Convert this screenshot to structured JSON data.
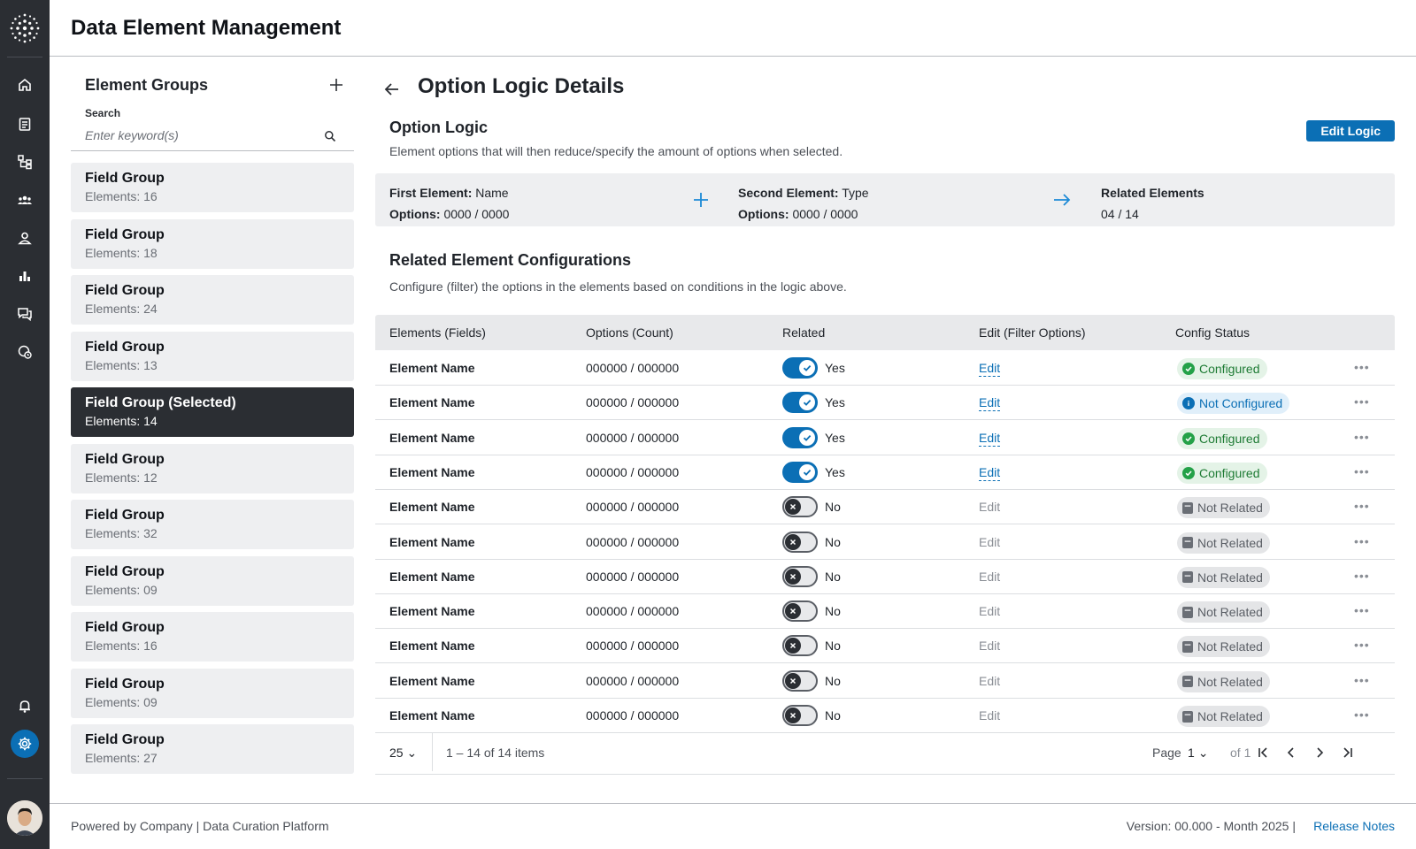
{
  "app": {
    "title": "Data Element Management"
  },
  "nav": {
    "items": [
      "home-icon",
      "clipboard-icon",
      "hierarchy-icon",
      "team-icon",
      "user-icon",
      "bar-chart-icon",
      "chat-icon",
      "settings-clock-icon"
    ],
    "bottom": [
      "bell-icon",
      "gear-icon",
      "avatar"
    ]
  },
  "groups": {
    "title": "Element Groups",
    "search_label": "Search",
    "search_placeholder": "Enter keyword(s)",
    "items": [
      {
        "name": "Field Group",
        "count": "Elements: 16",
        "selected": false
      },
      {
        "name": "Field Group",
        "count": "Elements: 18",
        "selected": false
      },
      {
        "name": "Field Group",
        "count": "Elements: 24",
        "selected": false
      },
      {
        "name": "Field Group",
        "count": "Elements: 13",
        "selected": false
      },
      {
        "name": "Field Group (Selected)",
        "count": "Elements: 14",
        "selected": true
      },
      {
        "name": "Field Group",
        "count": "Elements: 12",
        "selected": false
      },
      {
        "name": "Field Group",
        "count": "Elements: 32",
        "selected": false
      },
      {
        "name": "Field Group",
        "count": "Elements: 09",
        "selected": false
      },
      {
        "name": "Field Group",
        "count": "Elements: 16",
        "selected": false
      },
      {
        "name": "Field Group",
        "count": "Elements: 09",
        "selected": false
      },
      {
        "name": "Field Group",
        "count": "Elements: 27",
        "selected": false
      }
    ]
  },
  "main": {
    "page_title": "Option Logic Details",
    "logic": {
      "title": "Option Logic",
      "description": "Element options that will then reduce/specify the amount of options when selected.",
      "edit_button": "Edit Logic",
      "first_label": "First Element:",
      "first_value": "Name",
      "first_options_label": "Options:",
      "first_options_value": "0000 / 0000",
      "second_label": "Second Element:",
      "second_value": "Type",
      "second_options_label": "Options:",
      "second_options_value": "0000 / 0000",
      "related_label": "Related Elements",
      "related_value": "04 / 14"
    },
    "config": {
      "title": "Related Element Configurations",
      "description": "Configure (filter) the options in the elements based on conditions in the logic above.",
      "columns": [
        "Elements (Fields)",
        "Options (Count)",
        "Related",
        "Edit (Filter Options)",
        "Config Status"
      ],
      "rows": [
        {
          "name": "Element Name",
          "options": "000000 / 000000",
          "related": true,
          "related_label": "Yes",
          "edit": "Edit",
          "status": "Configured",
          "status_type": "configured"
        },
        {
          "name": "Element Name",
          "options": "000000 / 000000",
          "related": true,
          "related_label": "Yes",
          "edit": "Edit",
          "status": "Not Configured",
          "status_type": "notconf"
        },
        {
          "name": "Element Name",
          "options": "000000 / 000000",
          "related": true,
          "related_label": "Yes",
          "edit": "Edit",
          "status": "Configured",
          "status_type": "configured"
        },
        {
          "name": "Element Name",
          "options": "000000 / 000000",
          "related": true,
          "related_label": "Yes",
          "edit": "Edit",
          "status": "Configured",
          "status_type": "configured"
        },
        {
          "name": "Element Name",
          "options": "000000 / 000000",
          "related": false,
          "related_label": "No",
          "edit": "Edit",
          "status": "Not Related",
          "status_type": "notrel"
        },
        {
          "name": "Element Name",
          "options": "000000 / 000000",
          "related": false,
          "related_label": "No",
          "edit": "Edit",
          "status": "Not Related",
          "status_type": "notrel"
        },
        {
          "name": "Element Name",
          "options": "000000 / 000000",
          "related": false,
          "related_label": "No",
          "edit": "Edit",
          "status": "Not Related",
          "status_type": "notrel"
        },
        {
          "name": "Element Name",
          "options": "000000 / 000000",
          "related": false,
          "related_label": "No",
          "edit": "Edit",
          "status": "Not Related",
          "status_type": "notrel"
        },
        {
          "name": "Element Name",
          "options": "000000 / 000000",
          "related": false,
          "related_label": "No",
          "edit": "Edit",
          "status": "Not Related",
          "status_type": "notrel"
        },
        {
          "name": "Element Name",
          "options": "000000 / 000000",
          "related": false,
          "related_label": "No",
          "edit": "Edit",
          "status": "Not Related",
          "status_type": "notrel"
        },
        {
          "name": "Element Name",
          "options": "000000 / 000000",
          "related": false,
          "related_label": "No",
          "edit": "Edit",
          "status": "Not Related",
          "status_type": "notrel"
        }
      ]
    },
    "pager": {
      "page_size": "25",
      "range": "1 – 14 of 14 items",
      "page_label": "Page",
      "page_value": "1",
      "page_of": "of 1"
    }
  },
  "footer": {
    "powered": "Powered by Company | Data Curation Platform",
    "version": "Version: 00.000 - Month 2025  |",
    "release_notes": "Release Notes"
  },
  "colors": {
    "accent": "#0b6fb5",
    "rail": "#2b2e33",
    "success": "#24a148"
  }
}
